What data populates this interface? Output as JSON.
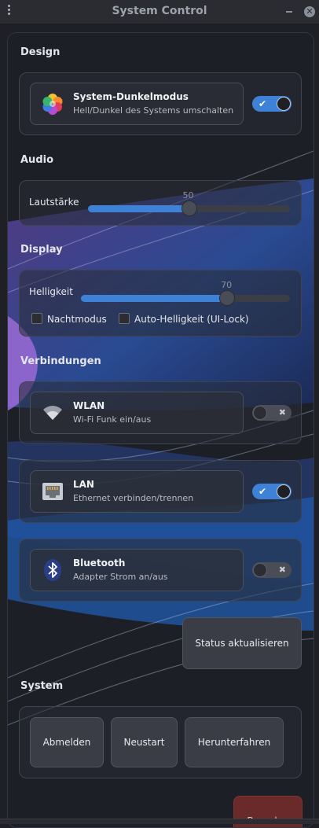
{
  "window": {
    "title": "System Control"
  },
  "sections": {
    "design": "Design",
    "audio": "Audio",
    "display": "Display",
    "connections": "Verbindungen",
    "system": "System"
  },
  "design": {
    "dark_mode": {
      "title": "System-Dunkelmodus",
      "subtitle": "Hell/Dunkel des Systems umschalten",
      "enabled": true,
      "icon": "color-palette-icon"
    }
  },
  "audio": {
    "volume": {
      "label": "Lautstärke",
      "value": 50,
      "max": 100
    }
  },
  "display": {
    "brightness": {
      "label": "Helligkeit",
      "value": 70,
      "max": 100
    },
    "night_mode": {
      "label": "Nachtmodus",
      "checked": false
    },
    "auto_brightness": {
      "label": "Auto-Helligkeit (UI-Lock)",
      "checked": false
    }
  },
  "connections": {
    "wlan": {
      "title": "WLAN",
      "subtitle": "Wi-Fi Funk ein/aus",
      "enabled": false,
      "icon": "wifi-icon"
    },
    "lan": {
      "title": "LAN",
      "subtitle": "Ethernet verbinden/trennen",
      "enabled": true,
      "icon": "ethernet-port-icon"
    },
    "bluetooth": {
      "title": "Bluetooth",
      "subtitle": "Adapter Strom an/aus",
      "enabled": false,
      "icon": "bluetooth-icon"
    },
    "refresh_label": "Status aktualisieren"
  },
  "system": {
    "logout_label": "Abmelden",
    "restart_label": "Neustart",
    "shutdown_label": "Herunterfahren",
    "exit_label": "Beenden"
  },
  "colors": {
    "accent": "#3d82d6",
    "background": "#1e2026",
    "danger": "#6b2a2a"
  }
}
